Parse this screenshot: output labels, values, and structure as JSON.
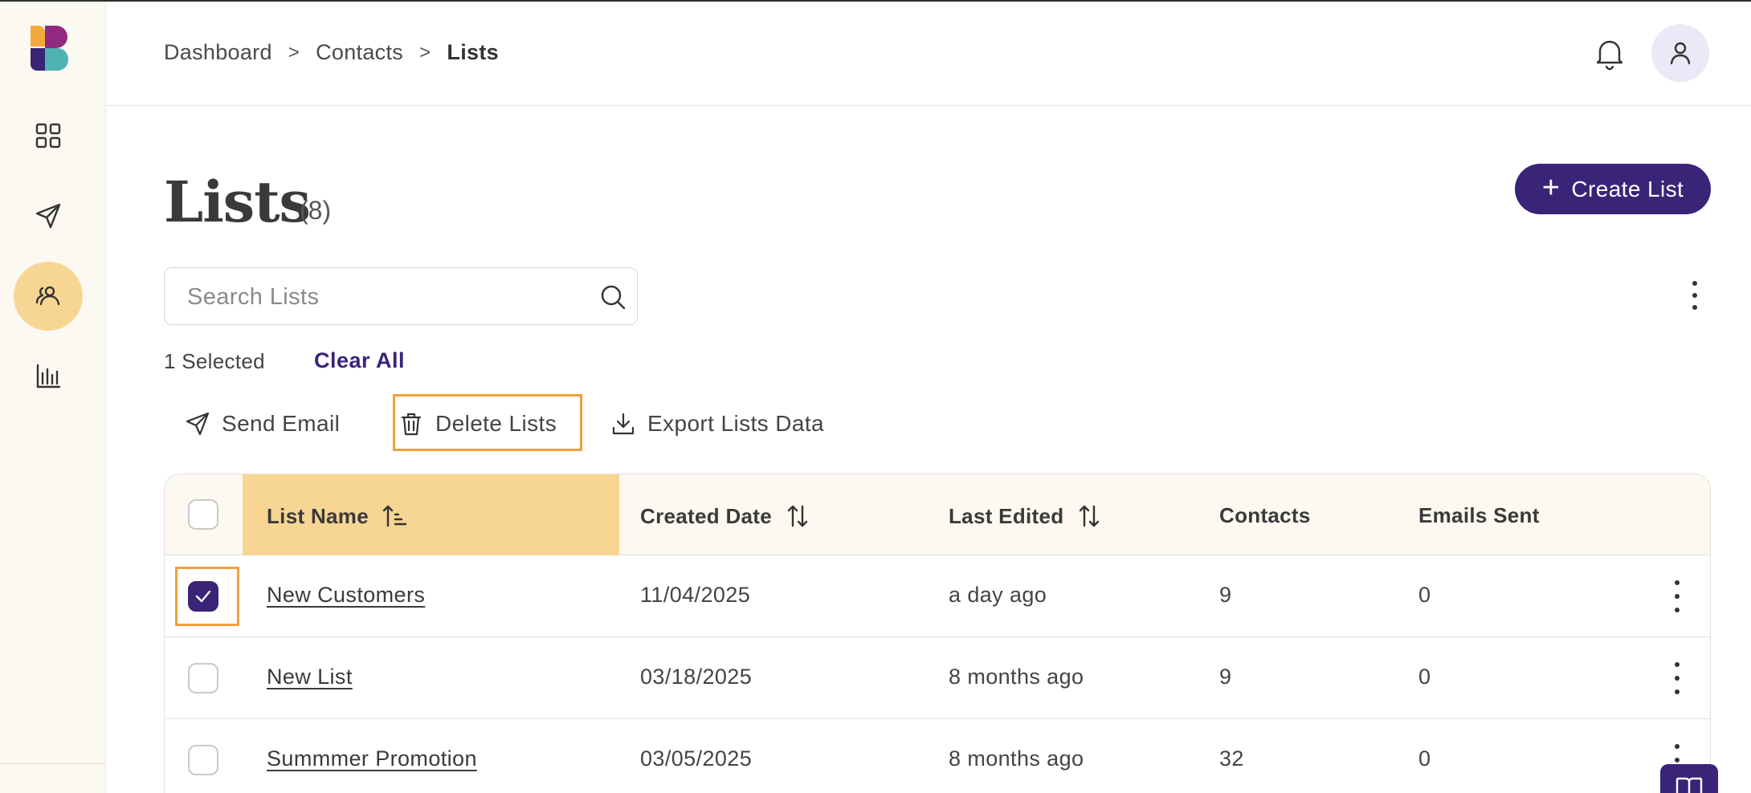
{
  "breadcrumb": {
    "items": [
      "Dashboard",
      "Contacts"
    ],
    "current": "Lists",
    "separator": ">"
  },
  "page": {
    "title": "Lists",
    "count": "(8)",
    "create_label": "Create List"
  },
  "search": {
    "placeholder": "Search Lists",
    "value": ""
  },
  "selection": {
    "count_text": "1 Selected",
    "clear_label": "Clear All"
  },
  "actions": {
    "send_email": "Send Email",
    "delete_lists": "Delete Lists",
    "export": "Export Lists Data"
  },
  "table": {
    "columns": [
      "List Name",
      "Created Date",
      "Last Edited",
      "Contacts",
      "Emails Sent"
    ],
    "rows": [
      {
        "name": "New Customers",
        "created": "11/04/2025",
        "edited": "a day ago",
        "contacts": "9",
        "emails": "0",
        "selected": true
      },
      {
        "name": "New List",
        "created": "03/18/2025",
        "edited": "8 months ago",
        "contacts": "9",
        "emails": "0",
        "selected": false
      },
      {
        "name": "Summmer Promotion",
        "created": "03/05/2025",
        "edited": "8 months ago",
        "contacts": "32",
        "emails": "0",
        "selected": false
      }
    ]
  },
  "sidebar": {
    "items": [
      {
        "icon": "grid-icon",
        "active": false
      },
      {
        "icon": "send-icon",
        "active": false
      },
      {
        "icon": "users-icon",
        "active": true
      },
      {
        "icon": "chart-icon",
        "active": false
      }
    ]
  },
  "colors": {
    "brand": "#3a2478",
    "accent": "#f7d593",
    "highlight_outline": "#f0a03c"
  }
}
